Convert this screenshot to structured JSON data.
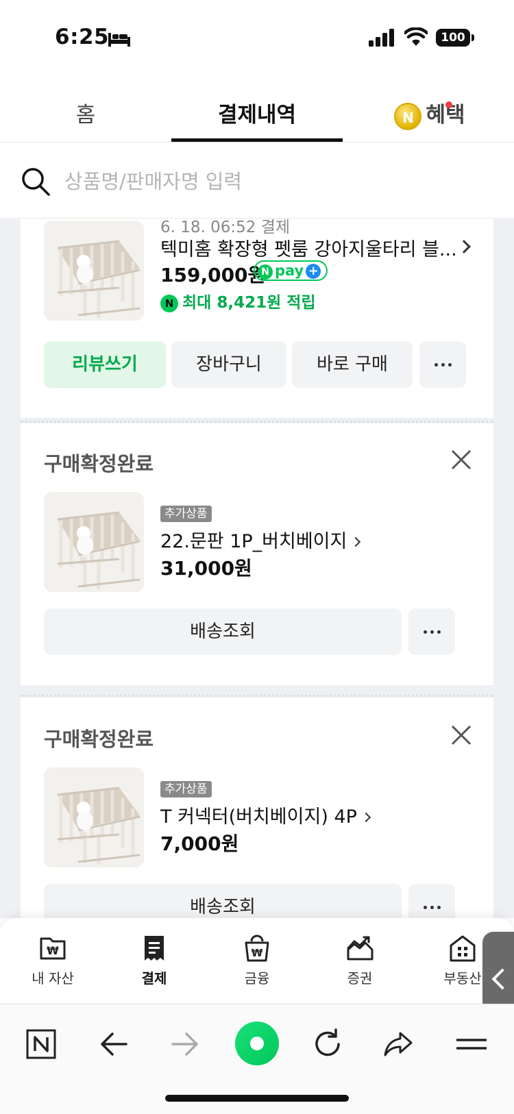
{
  "status_bar": {
    "time": "6:25",
    "battery": "100"
  },
  "tabs": {
    "home": "홈",
    "payments": "결제내역",
    "benefits": "혜택"
  },
  "search": {
    "placeholder": "상품명/판매자명 입력"
  },
  "orders": [
    {
      "date": "6. 18. 06:52 결제",
      "name": "텍미홈 확장형 펫룸 강아지울타리 블...",
      "price": "159,000원",
      "npay": "pay",
      "reward": "최대 8,421원 적립",
      "buttons": {
        "review": "리뷰쓰기",
        "cart": "장바구니",
        "buy": "바로 구매"
      }
    },
    {
      "status": "구매확정완료",
      "badge": "추가상품",
      "name": "22.문판 1P_버치베이지",
      "price": "31,000원",
      "button": "배송조회"
    },
    {
      "status": "구매확정완료",
      "badge": "추가상품",
      "name": "T 커넥터(버치베이지) 4P",
      "price": "7,000원",
      "button": "배송조회"
    }
  ],
  "bottom_nav": [
    {
      "label": "내 자산",
      "icon": "wallet-icon"
    },
    {
      "label": "결제",
      "icon": "receipt-icon",
      "active": true
    },
    {
      "label": "금융",
      "icon": "money-bag-icon"
    },
    {
      "label": "증권",
      "icon": "stock-chart-icon"
    },
    {
      "label": "부동산",
      "icon": "building-icon"
    }
  ],
  "colors": {
    "naver_green": "#03c75a",
    "review_bg": "#e2f7e7"
  }
}
